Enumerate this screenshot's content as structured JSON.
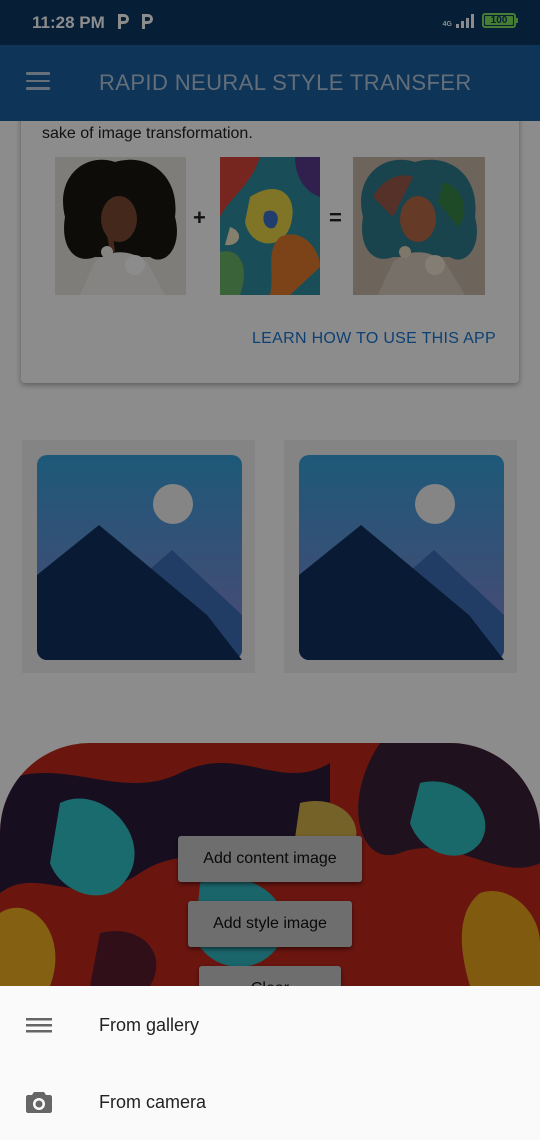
{
  "status_bar": {
    "time": "11:28 PM",
    "network": "4G",
    "battery": "100",
    "battery_level": 1.0
  },
  "app_bar": {
    "title": "RAPID NEURAL STYLE TRANSFER",
    "menu_icon": "hamburger-menu-icon"
  },
  "intro_card": {
    "text": "sake of image transformation.",
    "plus_symbol": "+",
    "equals_symbol": "=",
    "images": [
      "content-portrait",
      "style-painting",
      "stylized-result"
    ],
    "learn_link": "LEARN HOW TO USE THIS APP"
  },
  "image_slots": {
    "content_placeholder_icon": "image-placeholder-icon",
    "style_placeholder_icon": "image-placeholder-icon"
  },
  "actions": {
    "add_content": "Add content image",
    "add_style": "Add style image",
    "third_partial": "Clear"
  },
  "bottom_sheet": {
    "items": [
      {
        "label": "From gallery",
        "icon": "list-icon"
      },
      {
        "label": "From camera",
        "icon": "camera-icon"
      }
    ]
  },
  "colors": {
    "status_bar": "#0e3a63",
    "app_bar": "#1b5f9e",
    "link": "#1976d2",
    "battery": "#7ee35e"
  }
}
